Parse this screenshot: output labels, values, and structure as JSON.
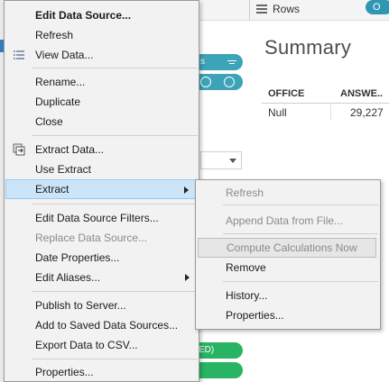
{
  "app": {
    "rows_shelf_label": "Rows",
    "rows_pill_text": "O",
    "top_pills": [
      "s",
      ""
    ],
    "bottom_pills": [
      "ED)",
      ""
    ],
    "summary_title": "Summary",
    "table": {
      "headers": [
        "OFFICE",
        "ANSWE.."
      ],
      "rows": [
        [
          "Null",
          "29,227"
        ]
      ]
    }
  },
  "menu": {
    "items": [
      {
        "label": "Edit Data Source...",
        "bold": true
      },
      {
        "label": "Refresh"
      },
      {
        "label": "View Data...",
        "icon": "table-icon"
      },
      {
        "label": "Rename..."
      },
      {
        "label": "Duplicate"
      },
      {
        "label": "Close"
      },
      {
        "label": "Extract Data...",
        "icon": "extract-icon"
      },
      {
        "label": "Use Extract"
      },
      {
        "label": "Extract",
        "submenu": true,
        "highlighted": true
      },
      {
        "label": "Edit Data Source Filters..."
      },
      {
        "label": "Replace Data Source...",
        "disabled": true
      },
      {
        "label": "Date Properties..."
      },
      {
        "label": "Edit Aliases...",
        "submenu": true
      },
      {
        "label": "Publish to Server..."
      },
      {
        "label": "Add to Saved Data Sources..."
      },
      {
        "label": "Export Data to CSV..."
      },
      {
        "label": "Properties..."
      }
    ]
  },
  "submenu": {
    "items": [
      {
        "label": "Refresh",
        "disabled": true
      },
      {
        "label": "Append Data from File...",
        "disabled": true
      },
      {
        "label": "Compute Calculations Now",
        "disabled": true,
        "highlighted": true
      },
      {
        "label": "Remove"
      },
      {
        "label": "History..."
      },
      {
        "label": "Properties..."
      }
    ]
  },
  "colors": {
    "highlight": "#cce4f7",
    "pill_teal": "#3ca3b8",
    "pill_green": "#28b463",
    "accent_blue": "#2f96b4"
  }
}
